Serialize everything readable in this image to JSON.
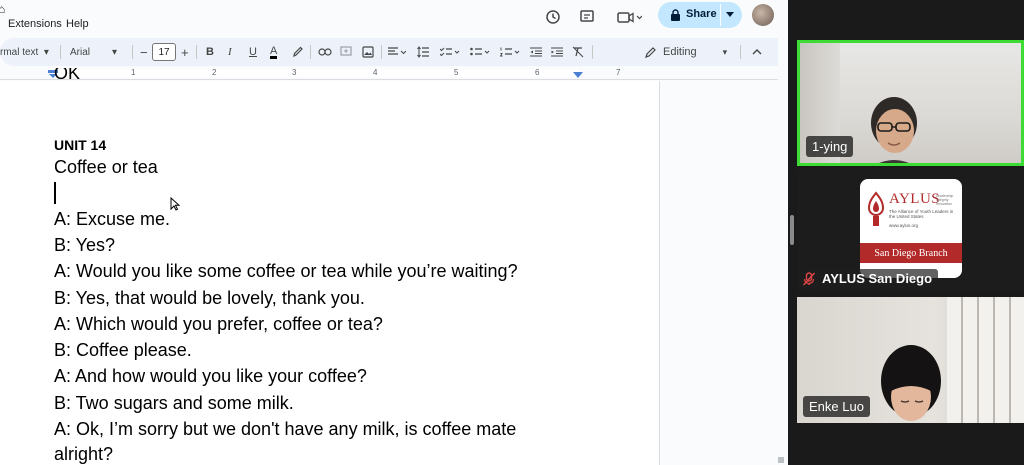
{
  "menu": {
    "extensions": "Extensions",
    "help": "Help"
  },
  "header": {
    "share_label": "Share"
  },
  "toolbar": {
    "style_label": "rmal text",
    "font_label": "Arial",
    "font_size": "17",
    "mode_label": "Editing"
  },
  "ruler": {
    "numbers": [
      "1",
      "2",
      "3",
      "4",
      "5",
      "6",
      "7"
    ]
  },
  "doc": {
    "partial_top": "OK",
    "unit_heading": "UNIT 14",
    "lesson_title": "Coffee or tea",
    "lines": [
      "A: Excuse me.",
      "B: Yes?",
      "A: Would you like some coffee or tea while you’re waiting?",
      "B: Yes, that would be lovely, thank you.",
      "A: Which would you prefer, coffee or tea?",
      "B: Coffee please.",
      "A: And how would you like your coffee?",
      "B: Two sugars and some milk.",
      "A: Ok, I’m sorry but we don't have any milk, is coffee mate",
      "alright?"
    ]
  },
  "participants": [
    {
      "name": "1-ying"
    },
    {
      "name": "AYLUS San Diego"
    },
    {
      "name": "Enke Luo"
    }
  ],
  "logo": {
    "title": "AYLUS",
    "tagline": "Leadership Integrity Innovation",
    "full_name": "The Alliance of Youth Leaders in the United States",
    "url": "www.aylus.org",
    "branch": "San Diego Branch"
  },
  "colors": {
    "share_bg": "#c2e7ff",
    "active_speaker": "#3ddc35",
    "aylus_red": "#b22a2a"
  }
}
